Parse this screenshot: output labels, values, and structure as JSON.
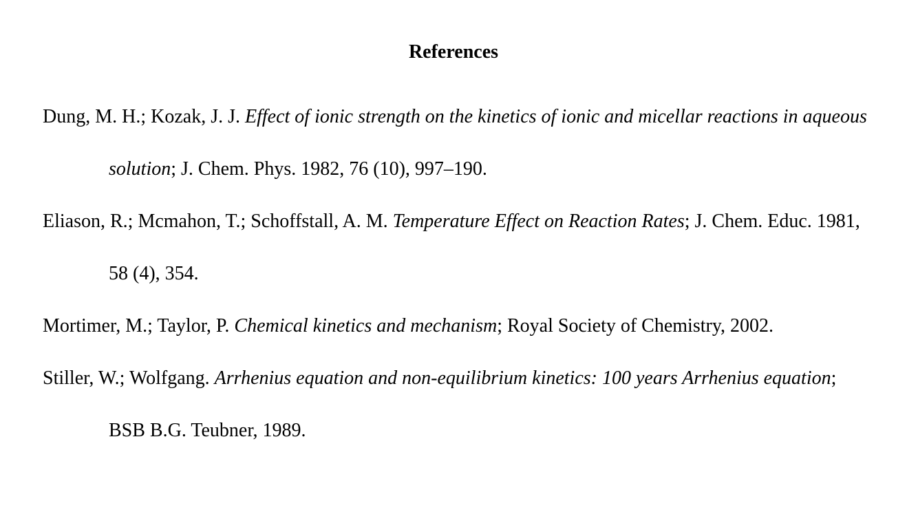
{
  "heading": "References",
  "references": [
    {
      "authors": "Dung, M. H.; Kozak, J. J. ",
      "title": "Effect of ionic strength on the kinetics of ionic and micellar reactions in aqueous solution",
      "rest": "; J. Chem. Phys. 1982, 76 (10), 997–190."
    },
    {
      "authors": "Eliason, R.; Mcmahon, T.; Schoffstall, A. M. ",
      "title": "Temperature Effect on Reaction Rates",
      "rest": "; J. Chem. Educ. 1981, 58 (4), 354."
    },
    {
      "authors": "Mortimer, M.; Taylor, P. ",
      "title": "Chemical kinetics and mechanism",
      "rest": "; Royal Society of Chemistry, 2002."
    },
    {
      "authors": "Stiller, W.; Wolfgang. ",
      "title": "Arrhenius equation and non-equilibrium kinetics: 100 years Arrhenius equation",
      "rest": "; BSB B.G. Teubner, 1989."
    }
  ]
}
